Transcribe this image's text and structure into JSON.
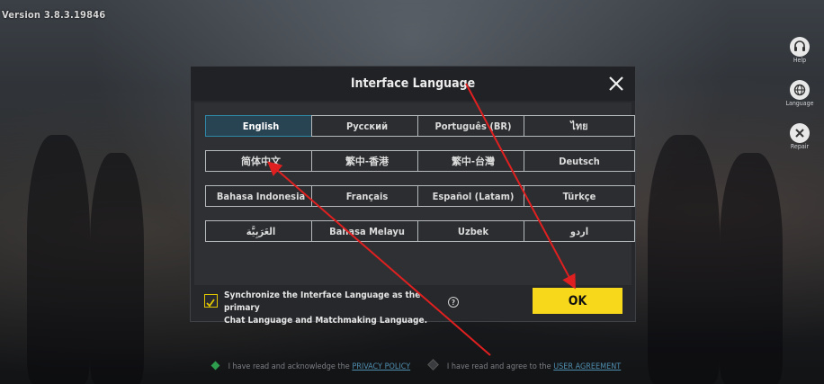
{
  "version": "Version 3.8.3.19846",
  "side_buttons": [
    {
      "label": "Help",
      "icon": "headset-icon"
    },
    {
      "label": "Language",
      "icon": "globe-icon"
    },
    {
      "label": "Repair",
      "icon": "wrench-icon"
    }
  ],
  "dialog": {
    "title": "Interface Language",
    "close_icon": "close-icon",
    "languages": [
      "English",
      "Русский",
      "Português (BR)",
      "ไทย",
      "简体中文",
      "繁中-香港",
      "繁中-台灣",
      "Deutsch",
      "Bahasa Indonesia",
      "Français",
      "Español (Latam)",
      "Türkçe",
      "العَرَبِيَّة",
      "Bahasa Melayu",
      "Uzbek",
      "اردو"
    ],
    "selected_language": "English",
    "sync_label_line1": "Synchronize the Interface Language as the primary",
    "sync_label_line2": "Chat Language and Matchmaking Language.",
    "sync_checked": true,
    "help_glyph": "?",
    "ok_label": "OK"
  },
  "footer": {
    "privacy_text": "I have read and acknowledge the",
    "privacy_link": "PRIVACY POLICY",
    "agreement_text": "I have read and agree to the",
    "agreement_link": "USER AGREEMENT"
  },
  "colors": {
    "accent_yellow": "#f7d81a",
    "selected_blue": "#2f88a8",
    "annotation_red": "#e02020"
  }
}
